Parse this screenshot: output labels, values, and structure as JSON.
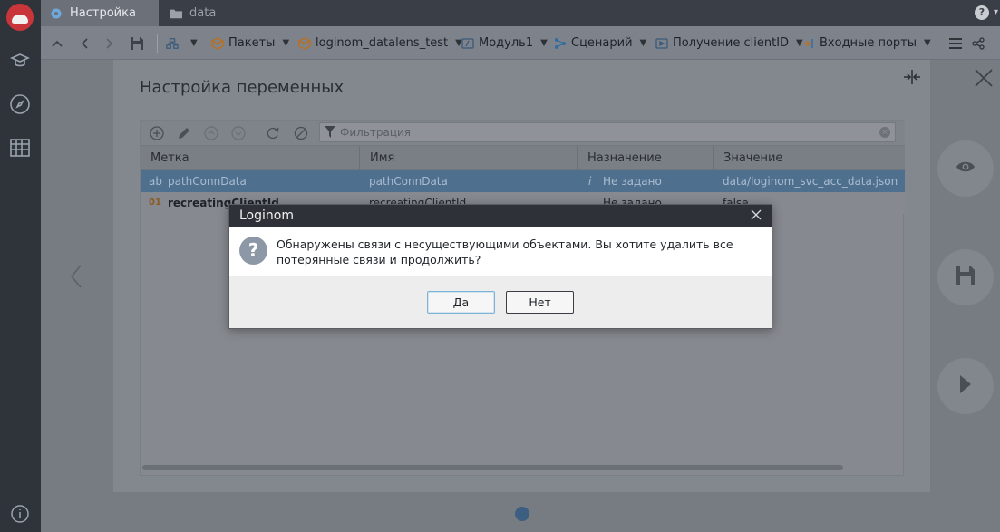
{
  "tabs": [
    {
      "label": "Настройка",
      "icon": "gear-icon",
      "active": true
    },
    {
      "label": "data",
      "icon": "folder-icon",
      "active": false
    }
  ],
  "help": {
    "label": "?",
    "icon": "help-icon"
  },
  "breadcrumbs": [
    {
      "label": "Пакеты",
      "icon": "package-icon"
    },
    {
      "label": "loginom_datalens_test",
      "icon": "package-icon"
    },
    {
      "label": "Модуль1",
      "icon": "module-icon"
    },
    {
      "label": "Сценарий",
      "icon": "scenario-icon"
    },
    {
      "label": "Получение clientID",
      "icon": "node-icon"
    },
    {
      "label": "Входные порты",
      "icon": "input-ports-icon"
    }
  ],
  "panel": {
    "title": "Настройка переменных"
  },
  "filter": {
    "placeholder": "Фильтрация"
  },
  "columns": [
    "Метка",
    "Имя",
    "Назначение",
    "Значение"
  ],
  "rows": [
    {
      "type_badge": "ab",
      "label": "pathConnData",
      "name": "pathConnData",
      "purpose": "Не задано",
      "value": "data/loginom_svc_acc_data.json",
      "selected": true
    },
    {
      "type_badge": "01",
      "label": "recreatingClientId",
      "name": "recreatingClientId",
      "purpose": "Не задано",
      "value": "false",
      "selected": false
    }
  ],
  "dialog": {
    "title": "Loginom",
    "message": "Обнаружены связи с несуществующими объектами. Вы хотите удалить все потерянные связи и продолжить?",
    "yes_label": "Да",
    "no_label": "Нет"
  },
  "colors": {
    "accent": "#4f6f8e",
    "dark": "#2e3238",
    "dot": "#3c5e80"
  }
}
